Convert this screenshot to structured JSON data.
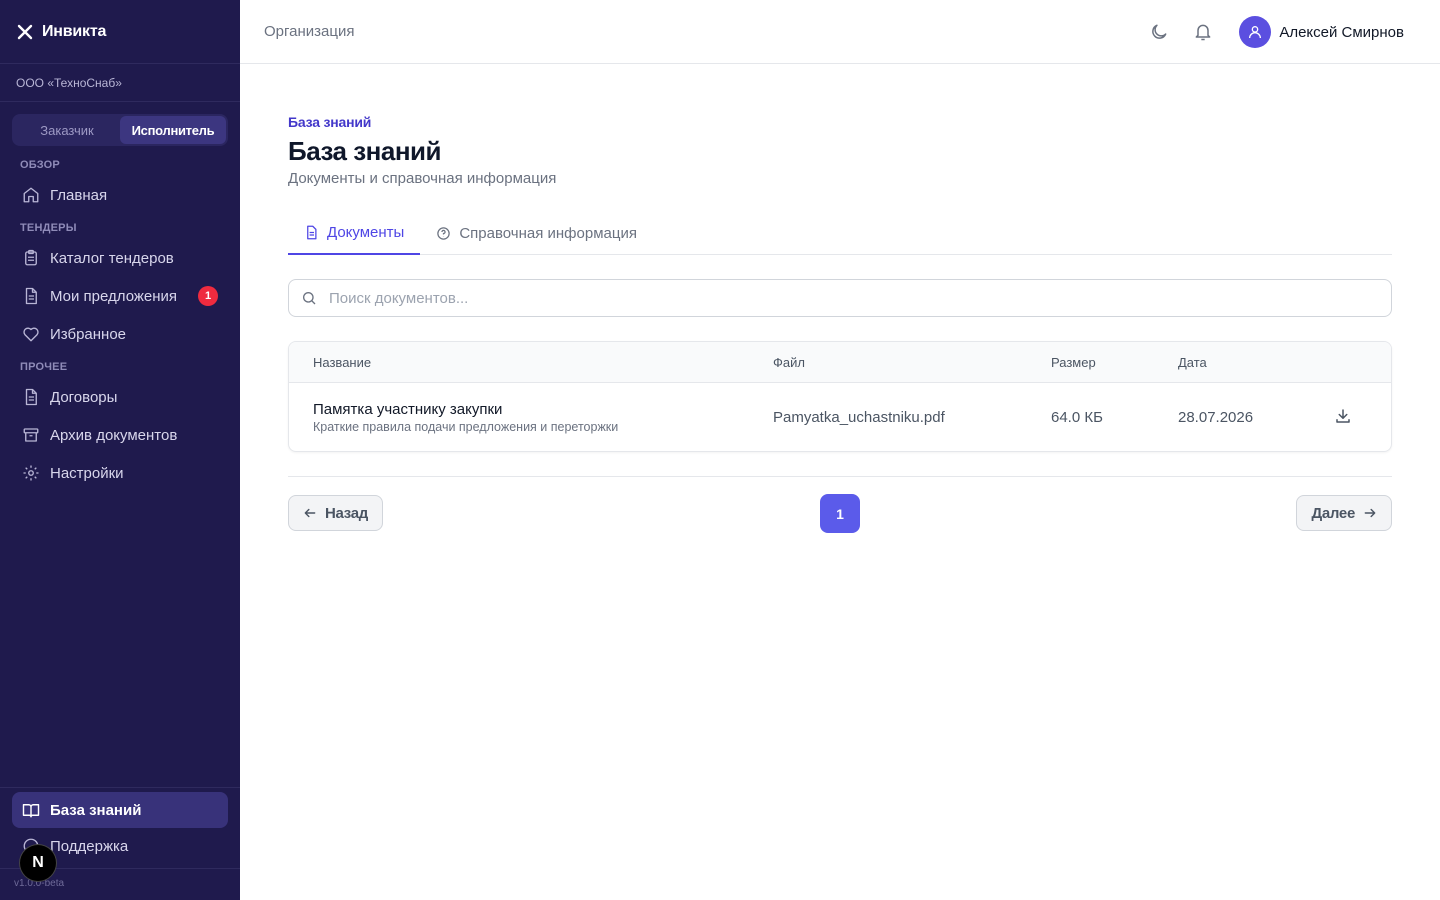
{
  "sidebar": {
    "brand": "Инвикта",
    "org": "ООО «ТехноСнаб»",
    "roles": [
      "Заказчик",
      "Исполнитель"
    ],
    "active_role": "Исполнитель",
    "sections": {
      "overview": "ОБЗОР",
      "tenders": "ТЕНДЕРЫ",
      "other": "ПРОЧЕЕ"
    },
    "items": {
      "home": "Главная",
      "catalog": "Каталог тендеров",
      "offers": "Мои предложения",
      "offers_badge": "1",
      "favorites": "Избранное",
      "contracts": "Договоры",
      "archive": "Архив документов",
      "settings": "Настройки",
      "knowledge": "База знаний",
      "support": "Поддержка"
    },
    "version": "v1.0.0-beta",
    "dev_badge": "N"
  },
  "topbar": {
    "title": "Организация",
    "user_name": "Алексей Смирнов"
  },
  "page": {
    "breadcrumb": "База знаний",
    "title": "База знаний",
    "subtitle": "Документы и справочная информация",
    "tabs": {
      "documents": "Документы",
      "reference": "Справочная информация"
    },
    "search_placeholder": "Поиск документов..."
  },
  "table": {
    "headers": {
      "name": "Название",
      "file": "Файл",
      "size": "Размер",
      "date": "Дата"
    },
    "rows": [
      {
        "title": "Памятка участнику закупки",
        "description": "Краткие правила подачи предложения и переторжки",
        "file": "Pamyatka_uchastniku.pdf",
        "size": "64.0 КБ",
        "date": "28.07.2026"
      }
    ]
  },
  "pagination": {
    "prev": "Назад",
    "next": "Далее",
    "current": "1"
  },
  "colors": {
    "sidebar_bg": "#1f1a4d",
    "accent": "#4f46e5",
    "badge": "#ef2b3f",
    "page_active": "#5b5bea"
  }
}
